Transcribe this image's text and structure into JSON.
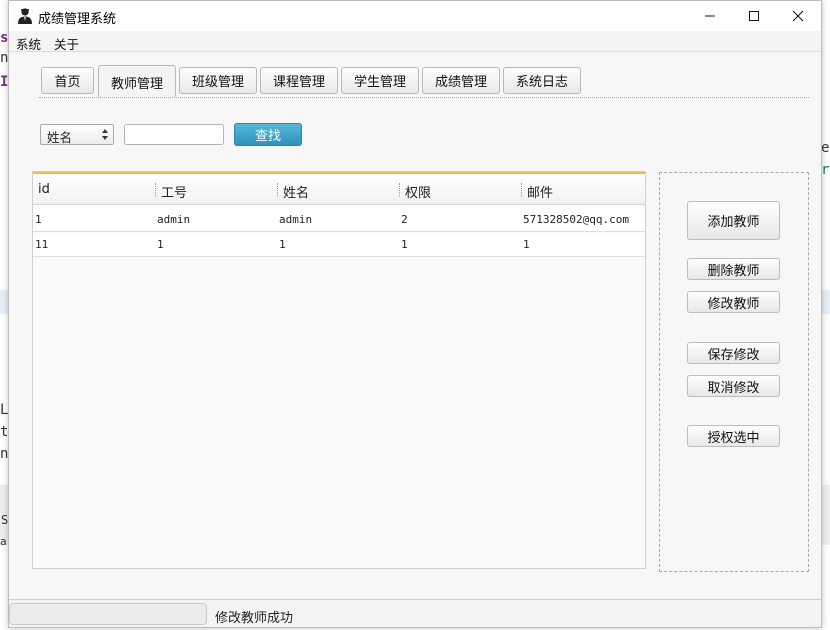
{
  "window": {
    "title": "成绩管理系统",
    "controls": {
      "minimize": "minimize-icon",
      "maximize": "maximize-icon",
      "close": "close-icon"
    }
  },
  "menu": {
    "items": [
      "系统",
      "关于"
    ]
  },
  "tabs": {
    "items": [
      "首页",
      "教师管理",
      "班级管理",
      "课程管理",
      "学生管理",
      "成绩管理",
      "系统日志"
    ],
    "active": "教师管理"
  },
  "search": {
    "field_selected": "姓名",
    "input_value": "",
    "button_label": "查找"
  },
  "table": {
    "columns": [
      "id",
      "工号",
      "姓名",
      "权限",
      "邮件"
    ],
    "rows": [
      [
        "1",
        "admin",
        "admin",
        "2",
        "571328502@qq.com"
      ],
      [
        "11",
        "1",
        "1",
        "1",
        "1"
      ]
    ]
  },
  "actions": {
    "add": "添加教师",
    "delete": "删除教师",
    "edit": "修改教师",
    "save": "保存修改",
    "cancel": "取消修改",
    "grant": "授权选中"
  },
  "status": {
    "message": "修改教师成功"
  },
  "colors": {
    "accent": "#2e93bc",
    "table_top": "#f2b84b",
    "window_bg": "#f7f7f7"
  }
}
